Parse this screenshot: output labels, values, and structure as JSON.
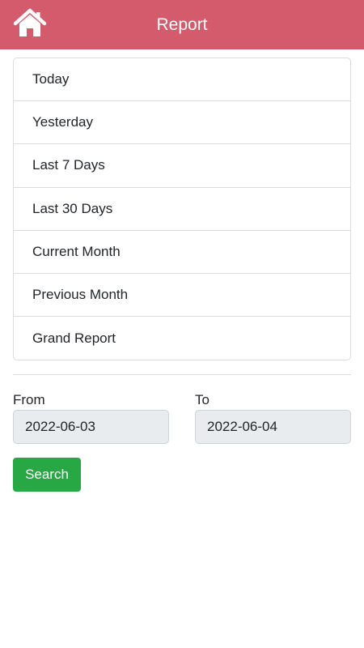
{
  "header": {
    "title": "Report",
    "home_icon": "home-icon",
    "background_color": "#d45b6b"
  },
  "report_options": [
    {
      "label": "Today"
    },
    {
      "label": "Yesterday"
    },
    {
      "label": "Last 7 Days"
    },
    {
      "label": "Last 30 Days"
    },
    {
      "label": "Current Month"
    },
    {
      "label": "Previous Month"
    },
    {
      "label": "Grand Report"
    }
  ],
  "date_range": {
    "from_label": "From",
    "from_value": "2022-06-03",
    "to_label": "To",
    "to_value": "2022-06-04"
  },
  "search": {
    "label": "Search",
    "color": "#28a745"
  }
}
